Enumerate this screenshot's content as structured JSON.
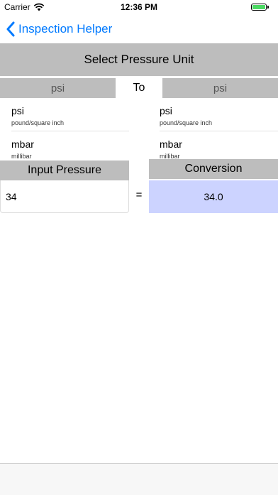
{
  "status_bar": {
    "carrier": "Carrier",
    "time": "12:36 PM"
  },
  "nav": {
    "back_label": "Inspection Helper"
  },
  "header": {
    "title": "Select Pressure Unit"
  },
  "tabs": {
    "from": "psi",
    "to": "To",
    "target": "psi"
  },
  "left_units": [
    {
      "name": "psi",
      "description": "pound/square inch"
    },
    {
      "name": "mbar",
      "description": "millibar"
    }
  ],
  "right_units": [
    {
      "name": "psi",
      "description": "pound/square inch"
    },
    {
      "name": "mbar",
      "description": "millibar"
    }
  ],
  "input": {
    "label": "Input Pressure",
    "value": "34"
  },
  "equals": "=",
  "conversion": {
    "label": "Conversion",
    "value": "34.0"
  },
  "colors": {
    "accent": "#007aff",
    "header_gray": "#bdbdbd",
    "conversion_bg": "#ccd3ff",
    "battery": "#4cd964"
  }
}
